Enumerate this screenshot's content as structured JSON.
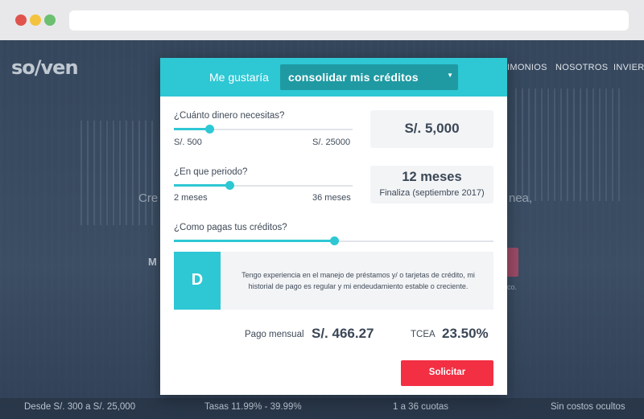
{
  "background": {
    "logo": "so/ven",
    "nav": [
      "IMONIOS",
      "NOSOTROS",
      "INVIER"
    ],
    "left_fragment": "Cre",
    "right_fragment": "nea,",
    "mid_fragment": "M",
    "small_fragment": "co.",
    "footer": [
      "Desde S/. 300 a S/. 25,000",
      "Tasas 11.99% - 39.99%",
      "1 a 36 cuotas",
      "Sin costos ocultos"
    ]
  },
  "modal": {
    "header": {
      "label": "Me gustaría",
      "select_value": "consolidar mis créditos"
    },
    "amount": {
      "question": "¿Cuánto dinero necesitas?",
      "min_label": "S/. 500",
      "max_label": "S/. 25000",
      "value_label": "S/. 5,000",
      "slider_fraction": 0.2
    },
    "period": {
      "question": "¿En que periodo?",
      "min_label": "2 meses",
      "max_label": "36 meses",
      "value_label": "12 meses",
      "sub_label": "Finaliza (septiembre 2017)",
      "slider_fraction": 0.31
    },
    "payment_history": {
      "question": "¿Como pagas tus créditos?",
      "slider_fraction": 0.5,
      "grade": "D",
      "description": "Tengo experiencia en el manejo de préstamos y/ o tarjetas de crédito, mi historial de pago es regular y mi endeudamiento estable o creciente."
    },
    "summary": {
      "monthly_label": "Pago mensual",
      "monthly_value": "S/. 466.27",
      "tcea_label": "TCEA",
      "tcea_value": "23.50%"
    },
    "apply_label": "Solicitar"
  },
  "colors": {
    "accent": "#2ec7d4",
    "select_bg": "#1f9aa3",
    "cta": "#f22f43",
    "text": "#3b4756"
  }
}
